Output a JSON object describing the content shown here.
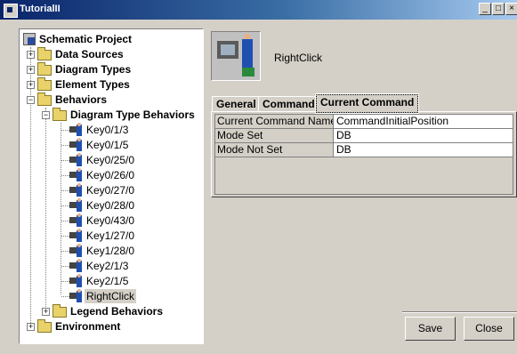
{
  "window": {
    "title": "TutorialII",
    "buttons": [
      "_",
      "□",
      "×"
    ]
  },
  "tree": {
    "root": "Schematic Project",
    "data_sources": "Data Sources",
    "diagram_types": "Diagram Types",
    "element_types": "Element Types",
    "behaviors": "Behaviors",
    "diagram_type_behaviors": "Diagram Type Behaviors",
    "behavior_items": [
      "Key0/1/3",
      "Key0/1/5",
      "Key0/25/0",
      "Key0/26/0",
      "Key0/27/0",
      "Key0/28/0",
      "Key0/43/0",
      "Key1/27/0",
      "Key1/28/0",
      "Key2/1/3",
      "Key2/1/5",
      "RightClick"
    ],
    "legend_behaviors": "Legend Behaviors",
    "environment": "Environment",
    "expand_symbols": {
      "collapsed": "+",
      "expanded": "−"
    }
  },
  "detail": {
    "behavior_name": "RightClick",
    "tabs": [
      "General",
      "Command",
      "Current Command"
    ],
    "active_tab": "Current Command",
    "properties": [
      {
        "name": "Current Command Name",
        "value": "CommandInitialPosition"
      },
      {
        "name": "Mode Set",
        "value": "DB"
      },
      {
        "name": "Mode Not Set",
        "value": "DB"
      }
    ]
  },
  "footer": {
    "save_label": "Save",
    "close_label": "Close"
  }
}
